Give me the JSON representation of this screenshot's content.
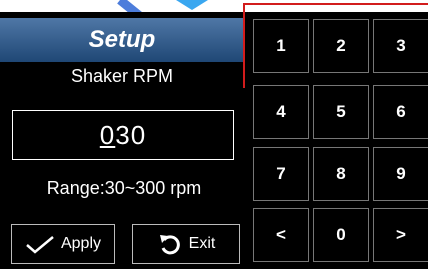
{
  "title": "Setup",
  "parameter_label": "Shaker RPM",
  "value": {
    "digit_1": "0",
    "digits_rest": "30"
  },
  "range_text": "Range:30~300 rpm",
  "buttons": {
    "apply": "Apply",
    "exit": "Exit"
  },
  "keypad": [
    "1",
    "2",
    "3",
    "4",
    "5",
    "6",
    "7",
    "8",
    "9",
    "<",
    "0",
    ">"
  ],
  "colors": {
    "title_bar": "#2f5a8c",
    "accent_red": "#d21c1c",
    "watermark": "#3a6fd8"
  }
}
